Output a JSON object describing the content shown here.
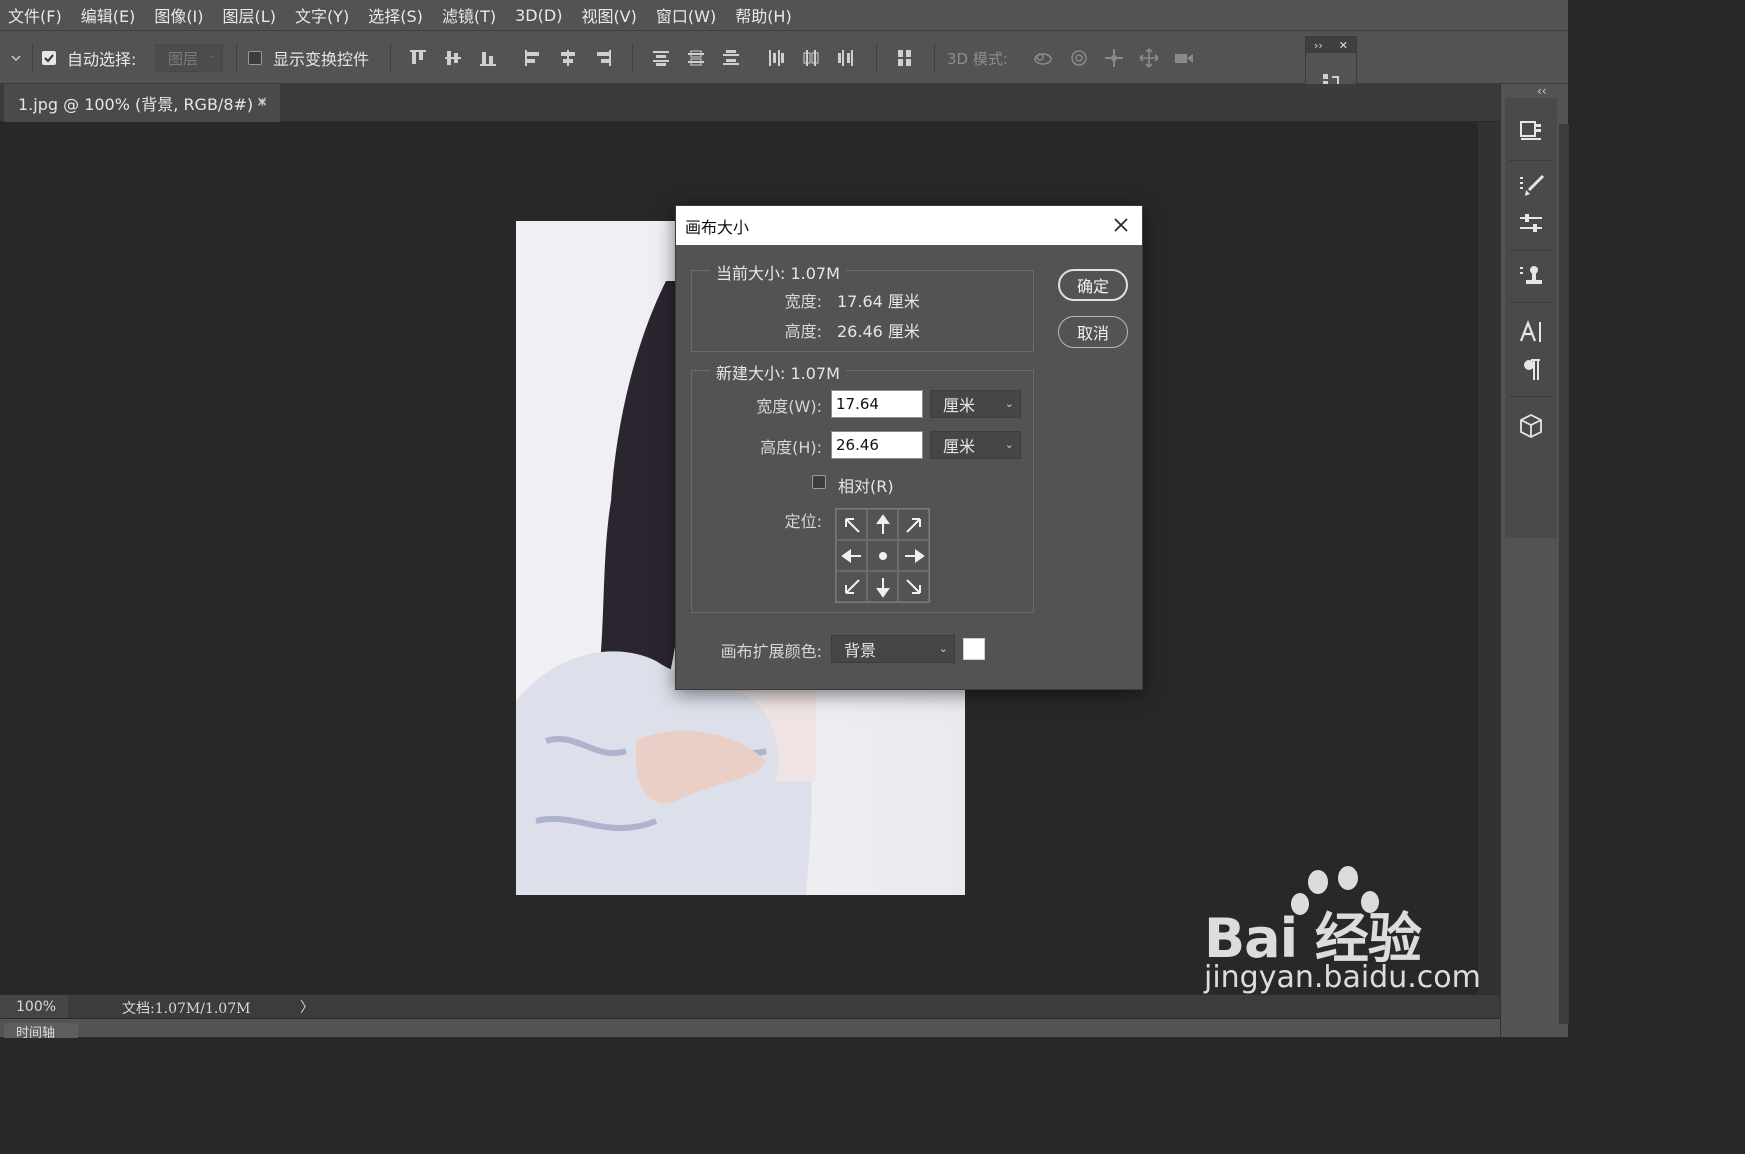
{
  "menu": [
    "文件(F)",
    "编辑(E)",
    "图像(I)",
    "图层(L)",
    "文字(Y)",
    "选择(S)",
    "滤镜(T)",
    "3D(D)",
    "视图(V)",
    "窗口(W)",
    "帮助(H)"
  ],
  "options": {
    "auto_select_label": "自动选择:",
    "auto_select_checked": true,
    "auto_select_target": "图层",
    "show_transform_label": "显示变换控件",
    "show_transform_checked": false,
    "mode_3d_label": "3D 模式:"
  },
  "tab": {
    "title": "1.jpg @ 100% (背景, RGB/8#) *",
    "close": "×"
  },
  "dialog": {
    "title": "画布大小",
    "current_size_label": "当前大小: 1.07M",
    "current_width_label": "宽度:",
    "current_width_value": "17.64 厘米",
    "current_height_label": "高度:",
    "current_height_value": "26.46 厘米",
    "new_size_label": "新建大小: 1.07M",
    "width_label": "宽度(W):",
    "width_value": "17.64",
    "width_unit": "厘米",
    "height_label": "高度(H):",
    "height_value": "26.46",
    "height_unit": "厘米",
    "relative_label": "相对(R)",
    "relative_checked": false,
    "anchor_label": "定位:",
    "extension_color_label": "画布扩展颜色:",
    "extension_color_value": "背景",
    "extension_swatch_color": "#ffffff",
    "ok_label": "确定",
    "cancel_label": "取消"
  },
  "status": {
    "zoom": "100%",
    "doc_info": "文档:1.07M/1.07M",
    "arrow": "〉"
  },
  "timeline_tab": "时间轴",
  "watermark": {
    "brand": "Bai 经验",
    "url": "jingyan.baidu.com"
  },
  "colors": {
    "panel": "#535353",
    "canvas_bg": "#282828",
    "dialog_title_bg": "#ffffff"
  }
}
